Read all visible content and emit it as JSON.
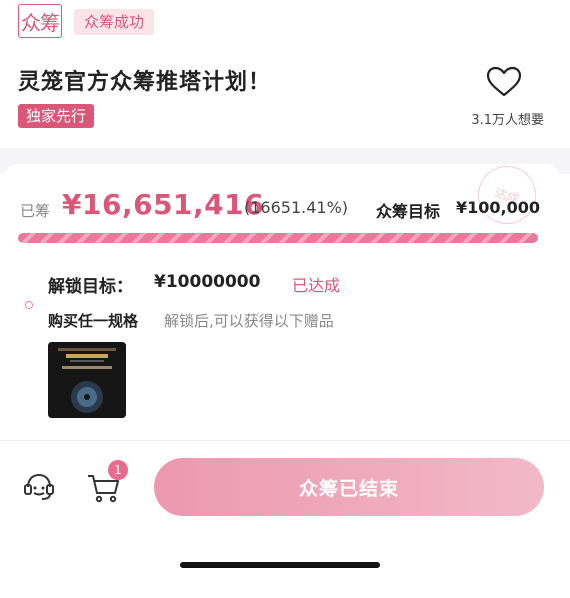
{
  "header": {
    "logo_text": "众筹",
    "status_tag": "众筹成功"
  },
  "project": {
    "title": "灵笼官方众筹推塔计划！",
    "exclusive_tag": "独家先行",
    "wants_count": "3.1万人想要",
    "favorite_icon": "heart-outline-icon"
  },
  "funding": {
    "stamp_text": "达成",
    "raised_label": "已筹",
    "raised_amount": "¥16,651,416",
    "raised_percent": "(16651.41%)",
    "goal_label": "众筹目标",
    "goal_amount": "¥100,000",
    "progress_fraction": 1.0,
    "bar_color": "#e67a98"
  },
  "unlock": {
    "label": "解锁目标：",
    "value": "¥10000000",
    "status": "已达成",
    "buy_label": "购买任一规格",
    "buy_desc": "解锁后,可以获得以下赠品",
    "gift_image": "cd-album-cover"
  },
  "bottom_bar": {
    "service_icon": "customer-service-icon",
    "cart_icon": "cart-icon",
    "cart_count": "1",
    "end_button_label": "众筹已结束",
    "accent_color": "#d9587a"
  }
}
